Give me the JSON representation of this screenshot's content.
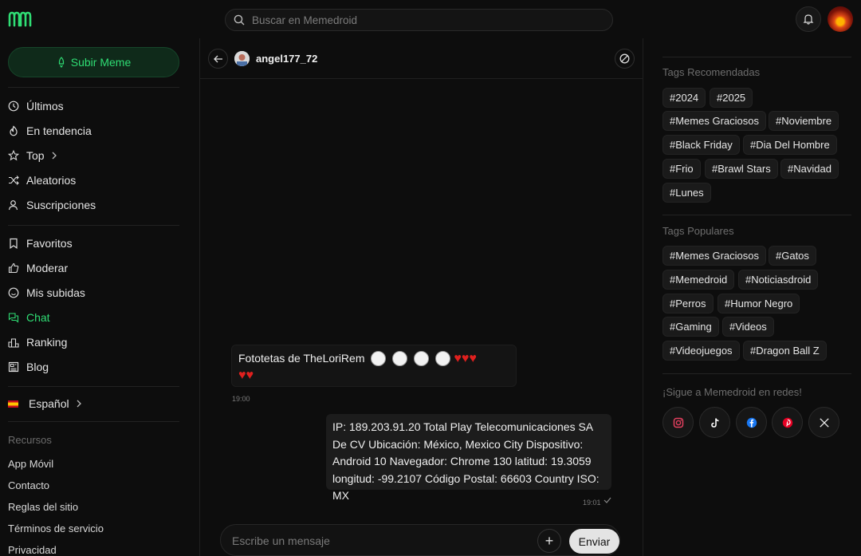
{
  "header": {
    "search_placeholder": "Buscar en Memedroid"
  },
  "colors": {
    "accent": "#2fdd74",
    "background": "#0d0d0d",
    "heart": "#e0201e"
  },
  "sidebar": {
    "upload_label": "Subir Meme",
    "items": [
      {
        "label": "Últimos",
        "icon": "clock-icon"
      },
      {
        "label": "En tendencia",
        "icon": "flame-icon"
      },
      {
        "label": "Top",
        "icon": "star-icon"
      },
      {
        "label": "Aleatorios",
        "icon": "shuffle-icon"
      },
      {
        "label": "Suscripciones",
        "icon": "user-icon"
      },
      {
        "label": "Favoritos",
        "icon": "bookmark-icon"
      },
      {
        "label": "Moderar",
        "icon": "thumb-up-icon"
      },
      {
        "label": "Mis subidas",
        "icon": "smile-icon"
      },
      {
        "label": "Chat",
        "icon": "chat-icon"
      },
      {
        "label": "Ranking",
        "icon": "podium-icon"
      },
      {
        "label": "Blog",
        "icon": "newspaper-icon"
      }
    ],
    "language": "Español",
    "resources_label": "Recursos",
    "footer_links": [
      "App Móvil",
      "Contacto",
      "Reglas del sitio",
      "Términos de servicio",
      "Privacidad"
    ]
  },
  "chat": {
    "username": "angel177_72",
    "messages": [
      {
        "direction": "in",
        "text": "Fototetas de TheLoriRem",
        "time": "19:00"
      },
      {
        "direction": "out",
        "text": "IP: 189.203.91.20 Total Play Telecomunicaciones SA De CV Ubicación: México, Mexico City Dispositivo: Android 10 Navegador: Chrome 130 latitud: 19.3059 longitud: -99.2107 Código Postal: 66603 Country ISO: MX",
        "time": "19:01"
      }
    ],
    "composer_placeholder": "Escribe un mensaje",
    "send_label": "Enviar"
  },
  "right": {
    "recommended_label": "Tags Recomendadas",
    "recommended_tags": [
      "#2024",
      "#2025",
      "#Memes Graciosos",
      "#Noviembre",
      "#Black Friday",
      "#Dia Del Hombre",
      "#Frio",
      "#Brawl Stars",
      "#Navidad",
      "#Lunes"
    ],
    "popular_label": "Tags Populares",
    "popular_tags": [
      "#Memes Graciosos",
      "#Gatos",
      "#Memedroid",
      "#Noticiasdroid",
      "#Perros",
      "#Humor Negro",
      "#Gaming",
      "#Videos",
      "#Videojuegos",
      "#Dragon Ball Z"
    ],
    "social_label": "¡Sigue a Memedroid en redes!",
    "social": [
      "instagram-icon",
      "tiktok-icon",
      "facebook-icon",
      "pinterest-icon",
      "x-icon"
    ]
  }
}
